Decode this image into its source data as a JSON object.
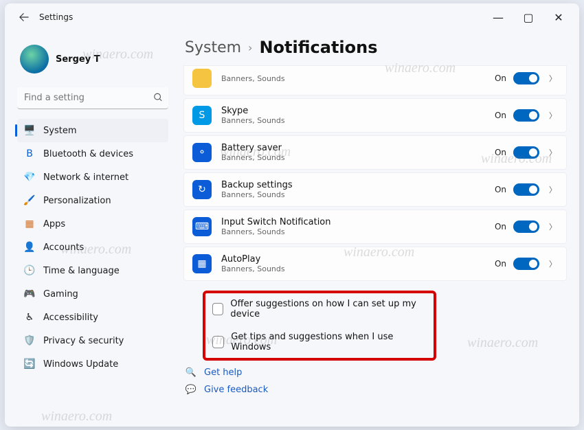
{
  "window": {
    "title": "Settings"
  },
  "titlebar": {
    "minimize": "—",
    "maximize": "▢",
    "close": "✕"
  },
  "account": {
    "name": "Sergey T"
  },
  "search": {
    "placeholder": "Find a setting"
  },
  "sidebar": {
    "items": [
      {
        "label": "System",
        "icon": "🖥️",
        "selected": true
      },
      {
        "label": "Bluetooth & devices",
        "icon": "B",
        "iconColor": "#0a5fd6"
      },
      {
        "label": "Network & internet",
        "icon": "💎"
      },
      {
        "label": "Personalization",
        "icon": "🖌️"
      },
      {
        "label": "Apps",
        "icon": "▦",
        "iconColor": "#d46f1f"
      },
      {
        "label": "Accounts",
        "icon": "👤"
      },
      {
        "label": "Time & language",
        "icon": "🕒"
      },
      {
        "label": "Gaming",
        "icon": "🎮"
      },
      {
        "label": "Accessibility",
        "icon": "♿"
      },
      {
        "label": "Privacy & security",
        "icon": "🛡️"
      },
      {
        "label": "Windows Update",
        "icon": "🔄"
      }
    ]
  },
  "breadcrumb": {
    "parent": "System",
    "sep": "›",
    "current": "Notifications"
  },
  "apps": [
    {
      "title": "",
      "subtitle": "Banners, Sounds",
      "state": "On",
      "iconBg": "#f5c542",
      "iconGlyph": "",
      "clipped": true
    },
    {
      "title": "Skype",
      "subtitle": "Banners, Sounds",
      "state": "On",
      "iconBg": "#0099e5",
      "iconGlyph": "S"
    },
    {
      "title": "Battery saver",
      "subtitle": "Banners, Sounds",
      "state": "On",
      "iconBg": "#0b5cd6",
      "iconGlyph": "⚬"
    },
    {
      "title": "Backup settings",
      "subtitle": "Banners, Sounds",
      "state": "On",
      "iconBg": "#0b5cd6",
      "iconGlyph": "↻"
    },
    {
      "title": "Input Switch Notification",
      "subtitle": "Banners, Sounds",
      "state": "On",
      "iconBg": "#0b5cd6",
      "iconGlyph": "⌨"
    },
    {
      "title": "AutoPlay",
      "subtitle": "Banners, Sounds",
      "state": "On",
      "iconBg": "#0b5cd6",
      "iconGlyph": "▦"
    }
  ],
  "checks": {
    "c1": "Offer suggestions on how I can set up my device",
    "c2": "Get tips and suggestions when I use Windows"
  },
  "help": {
    "get_help": "Get help",
    "feedback": "Give feedback"
  },
  "watermark": "winaero.com"
}
